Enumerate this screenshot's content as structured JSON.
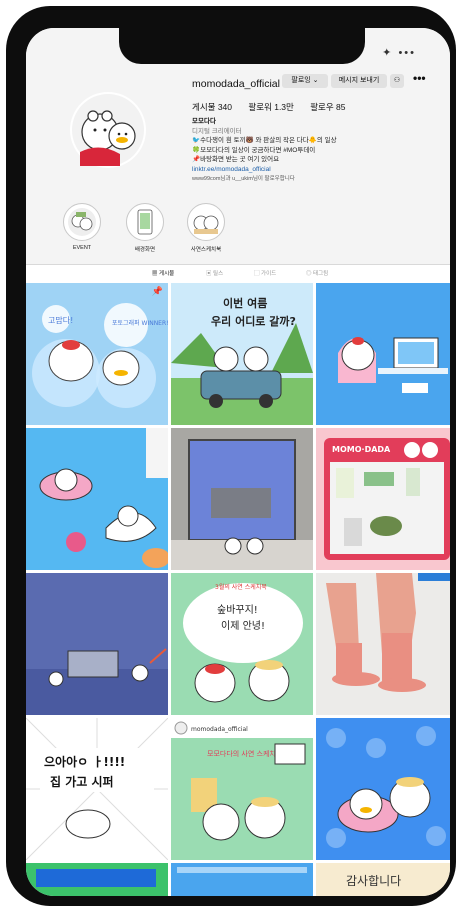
{
  "profile": {
    "username": "momodada_official",
    "follow_label": "팔로잉 ⌄",
    "message_label": "메시지 보내기",
    "more_label": "•••",
    "top_icons": "✦  •••",
    "stats": {
      "posts": "게시물 340",
      "followers": "팔로워 1.3만",
      "following": "팔로우 85"
    },
    "bio": {
      "name": "모모다다",
      "category": "디지털 크리에이터",
      "line1": "🐦수다쟁이 흰 토끼🐻 와 판살의 작은 다다🐥의 일상",
      "line2": "🍀모모다다의 일상이 궁금하다면 #MO투데이",
      "line3": "📌바탕화면 받는 곳 여기 있어요",
      "link": "linktr.ee/momodada_official"
    },
    "followed_by": "www99com님과 u__ukim님이 팔로우합니다"
  },
  "highlights": [
    {
      "label": "EVENT"
    },
    {
      "label": "배경화면"
    },
    {
      "label": "사연스케치북"
    }
  ],
  "tabs": [
    {
      "label": "▦ 게시물",
      "active": true
    },
    {
      "label": "▣ 릴스",
      "active": false
    },
    {
      "label": "▢ 가이드",
      "active": false
    },
    {
      "label": "◎ 태그됨",
      "active": false
    }
  ],
  "posts": [
    {
      "kind": "bubble",
      "text1": "고맙다!",
      "text2": "포토그래퍼 WINNER!"
    },
    {
      "kind": "car",
      "text1": "이번 여름",
      "text2": "우리 어디로 갈까?"
    },
    {
      "kind": "desk"
    },
    {
      "kind": "pool"
    },
    {
      "kind": "window"
    },
    {
      "kind": "product",
      "text1": "MOMO·DADA"
    },
    {
      "kind": "bus"
    },
    {
      "kind": "sketch",
      "text1": "3월의 사연 스케치북",
      "text2": "숲바꾸지!",
      "text3": "이제 안녕!"
    },
    {
      "kind": "boots"
    },
    {
      "kind": "manga",
      "text1": "으아아ㅇ ㅏ!!!!",
      "text2": "집 가고 시퍼"
    },
    {
      "kind": "story",
      "text1": "momodada_official",
      "text2": "모모다다의 사연 스케치북"
    },
    {
      "kind": "swim"
    },
    {
      "kind": "partial"
    },
    {
      "kind": "partial2"
    },
    {
      "kind": "thanks",
      "text1": "감사합니다"
    }
  ],
  "colors": {
    "accent_blue": "#3f8ff0",
    "sky": "#4aa5ee",
    "pink": "#e23d5a",
    "green": "#9adcb2"
  }
}
